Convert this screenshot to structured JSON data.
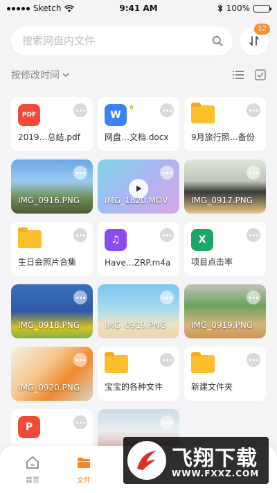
{
  "status_bar": {
    "carrier": "Sketch",
    "time": "9:41 AM",
    "battery": "100%",
    "battery_level": 1.0
  },
  "search": {
    "placeholder": "搜索网盘内文件",
    "value": "",
    "sort_badge": "12"
  },
  "toolbar": {
    "sort_label": "按修改时间"
  },
  "files": [
    {
      "type": "pdf",
      "icon": "pdf-icon",
      "icon_text": "PDF",
      "color": "#f04b3a",
      "name": "2019…总结.pdf"
    },
    {
      "type": "word",
      "icon": "word-icon",
      "icon_text": "W",
      "color": "#3b82f6",
      "name": "网盘…文档.docx",
      "starred": true
    },
    {
      "type": "folder",
      "icon": "folder-icon",
      "name": "9月旅行照…备份"
    },
    {
      "type": "image",
      "name": "IMG_0916.PNG",
      "bg": "linear-gradient(180deg,#6aa6e6 0%,#9ccbf0 40%,#6f8e56 70%,#4b5a3a 100%)"
    },
    {
      "type": "video",
      "name": "IMG_1820.MOV",
      "bg": "linear-gradient(135deg,#7fd6e8 0%,#a6b9f2 45%,#d8a6e6 100%)"
    },
    {
      "type": "image",
      "name": "IMG_0917.PNG",
      "bg": "linear-gradient(180deg,#dfe5dc 0%,#bfc6b7 40%,#3a3a36 60%,#e7c68a 100%)"
    },
    {
      "type": "folder",
      "icon": "folder-icon",
      "name": "生日会照片合集"
    },
    {
      "type": "audio",
      "icon": "music-icon",
      "icon_text": "♫",
      "color": "#8b4bf0",
      "name": "Have…ZRP.m4a"
    },
    {
      "type": "excel",
      "icon": "excel-icon",
      "icon_text": "X",
      "color": "#1ba66a",
      "name": "项目点击率"
    },
    {
      "type": "image",
      "name": "IMG_0918.PNG",
      "bg": "linear-gradient(180deg,#3a6fbf 0%,#2f59a6 50%,#d9c21f 80%,#7fb24a 100%)"
    },
    {
      "type": "image",
      "name": "IMG_0919.PNG",
      "bg": "linear-gradient(180deg,#7fc6ef 0%,#a5d9ee 45%,#f0e3c2 75%,#e8d4b0 100%)"
    },
    {
      "type": "image",
      "name": "IMG_0919.PNG",
      "bg": "linear-gradient(180deg,#bfc4b8 0%,#6fa05c 40%,#d8b47c 75%,#c99556 100%)"
    },
    {
      "type": "image",
      "name": "IMG_0920.PNG",
      "bg": "linear-gradient(135deg,#f3efe6 0%,#f6c58c 40%,#f08a2b 65%,#d8d2c4 100%)"
    },
    {
      "type": "folder",
      "icon": "folder-icon",
      "name": "宝宝的各种文件"
    },
    {
      "type": "folder",
      "icon": "folder-icon",
      "name": "新建文件夹"
    },
    {
      "type": "ppt",
      "icon": "ppt-icon",
      "icon_text": "P",
      "color": "#f04b3a",
      "name": ""
    },
    {
      "type": "image",
      "name": "",
      "bg": "linear-gradient(180deg,#c9dbe7 0%,#e9eef1 40%,#e3b9b9 70%,#8f6b5a 100%)"
    }
  ],
  "tabs": [
    {
      "label": "首页",
      "icon": "home-icon",
      "active": false
    },
    {
      "label": "文件",
      "icon": "folder-icon",
      "active": true
    }
  ],
  "watermark": {
    "cn": "飞翔下载",
    "url": "WWW.FXXZ.COM"
  },
  "colors": {
    "accent": "#f5832b",
    "folder": "#fcbf2c"
  }
}
